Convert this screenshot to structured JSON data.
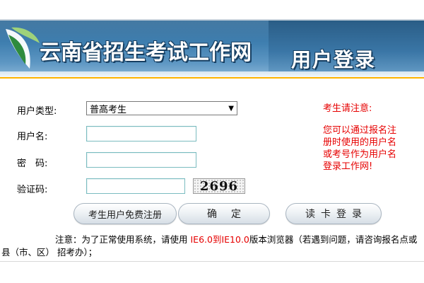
{
  "banner": {
    "site_title": "云南省招生考试工作网",
    "login_title": "用户登录",
    "logo_icon": "leaf-logo-icon"
  },
  "form": {
    "user_type_label": "用户类型:",
    "user_type_selected": "普高考生",
    "username_label": "用户名:",
    "username_value": "",
    "password_label": "密　码:",
    "password_value": "",
    "captcha_label": "验证码:",
    "captcha_value": "",
    "captcha_image_text": "2696"
  },
  "buttons": {
    "register": "考生用户免费注册",
    "confirm": "确定",
    "read_card": "读卡登录"
  },
  "notice": {
    "title": "考生请注意:",
    "body": "您可以通过报名注册时使用的用户名或考号作为用户名登录工作网!"
  },
  "footer": {
    "prefix": "注意：为了正常使用系统，请使用",
    "browser": "IE6.0到IE10.0",
    "suffix": "版本浏览器（若遇到问题，请咨询报名点或县（市、区） 招考办）；"
  },
  "colors": {
    "banner_blue": "#3f7fb0",
    "notice_red": "#e60000",
    "input_border": "#7bbcc0"
  }
}
